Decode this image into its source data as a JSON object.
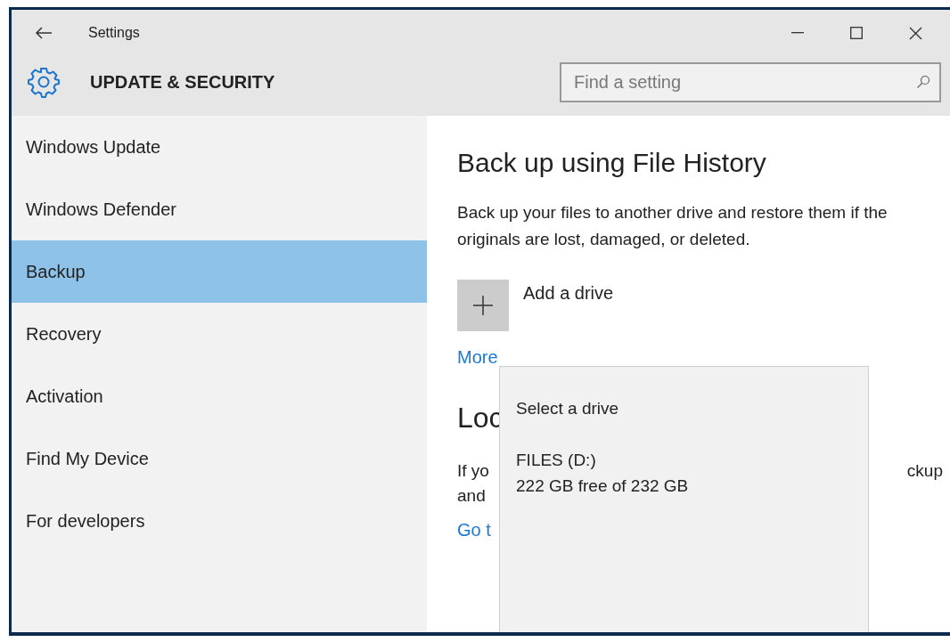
{
  "window": {
    "title": "Settings"
  },
  "header": {
    "title": "UPDATE & SECURITY"
  },
  "search": {
    "placeholder": "Find a setting"
  },
  "sidebar": {
    "items": [
      {
        "label": "Windows Update",
        "selected": false
      },
      {
        "label": "Windows Defender",
        "selected": false
      },
      {
        "label": "Backup",
        "selected": true
      },
      {
        "label": "Recovery",
        "selected": false
      },
      {
        "label": "Activation",
        "selected": false
      },
      {
        "label": "Find My Device",
        "selected": false
      },
      {
        "label": "For developers",
        "selected": false
      }
    ]
  },
  "content": {
    "title": "Back up using File History",
    "description": "Back up your files to another drive and restore them if the originals are lost, damaged, or deleted.",
    "add_drive": {
      "label": "Add a drive"
    },
    "more_link": "More",
    "section_heading": "Loc",
    "section_text_left": [
      "If yo",
      "and"
    ],
    "section_text_right": "ckup",
    "link": "Go t"
  },
  "flyout": {
    "title": "Select a drive",
    "drives": [
      {
        "name": "FILES (D:)",
        "space": "222 GB free of 232 GB"
      }
    ]
  }
}
